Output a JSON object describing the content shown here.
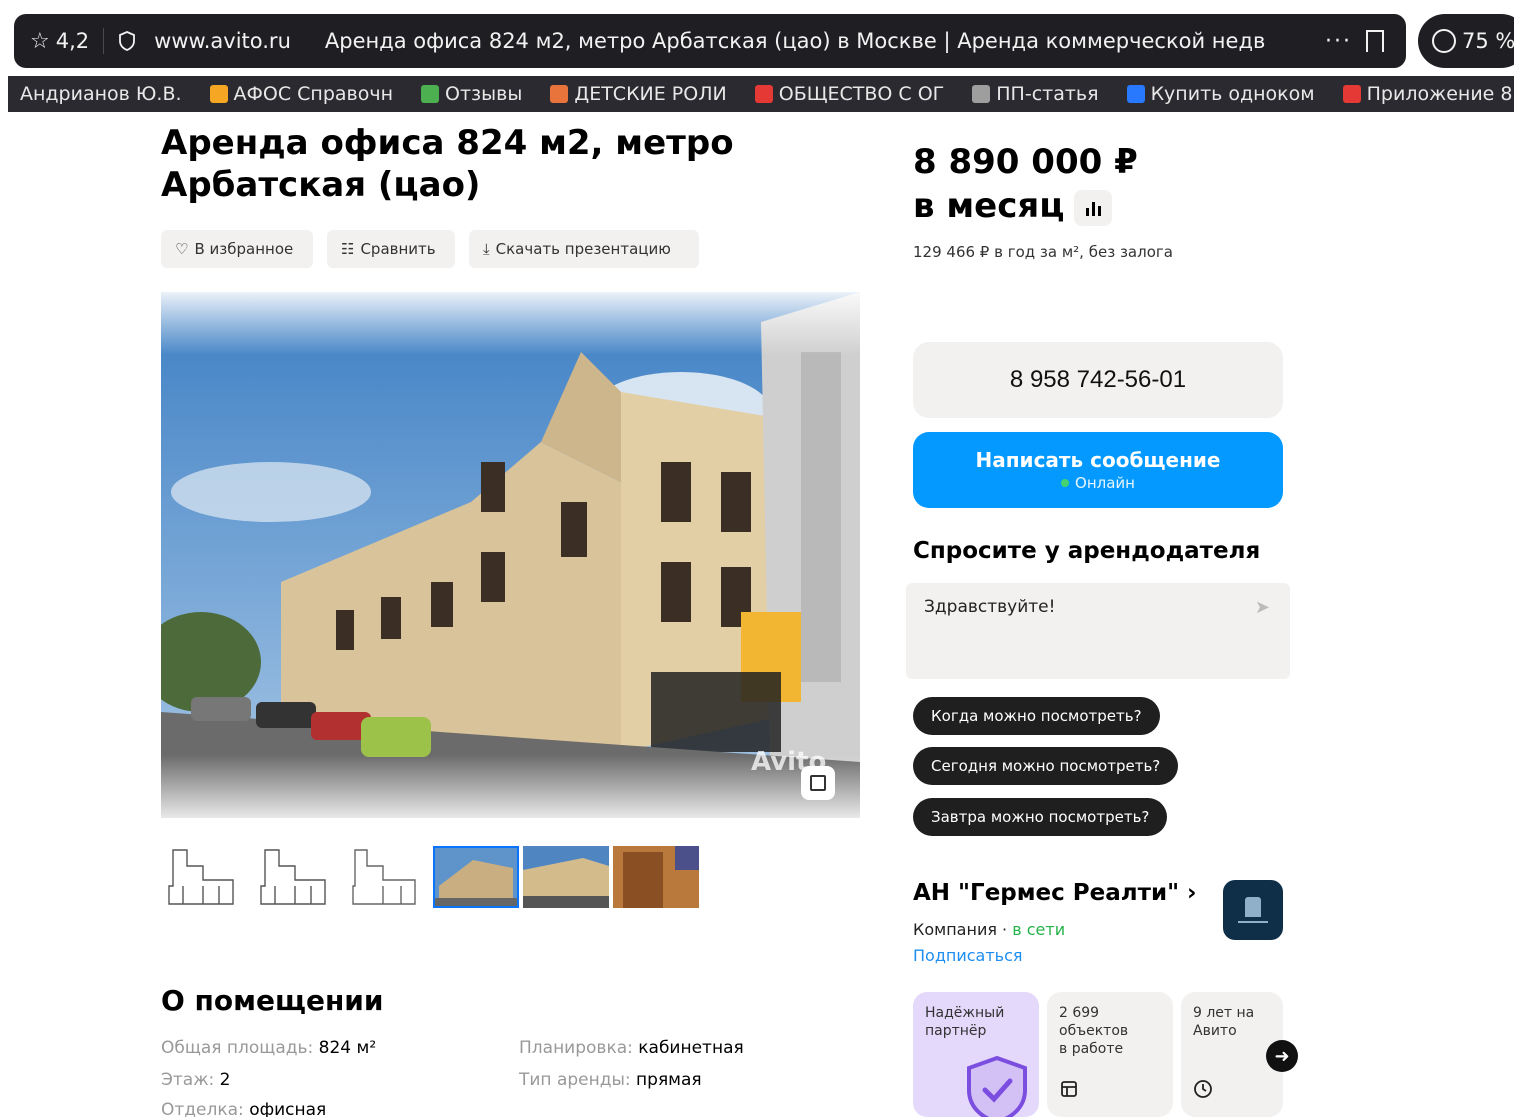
{
  "browser": {
    "rating": "4,2",
    "domain": "www.avito.ru",
    "page_title": "Аренда офиса 824 м2, метро Арбатская (цао) в Москве | Аренда коммерческой недви...",
    "more": "···",
    "zoom": "75 %"
  },
  "bookmarks": [
    {
      "label": "Андрианов Ю.В.",
      "color": "#7a7a80"
    },
    {
      "label": "АФОС Справочн",
      "color": "#f5a623"
    },
    {
      "label": "Отзывы",
      "color": "#4caf50"
    },
    {
      "label": "ДЕТСКИЕ РОЛИ",
      "color": "#e8743b"
    },
    {
      "label": "ОБЩЕСТВО С ОГ",
      "color": "#e53935"
    },
    {
      "label": "ПП-статья",
      "color": "#9e9e9e"
    },
    {
      "label": "Купить одноком",
      "color": "#2979ff"
    },
    {
      "label": "Приложение 8. С",
      "color": "#e53935"
    }
  ],
  "listing": {
    "title": "Аренда офиса 824 м2, метро Арбатская (цао)",
    "actions": {
      "favorite": "В избранное",
      "compare": "Сравнить",
      "download": "Скачать презентацию"
    },
    "watermark": "Avito"
  },
  "about": {
    "heading": "О помещении",
    "specs": [
      {
        "key": "Общая площадь: ",
        "value": "824 м²"
      },
      {
        "key": "Планировка: ",
        "value": "кабинетная"
      },
      {
        "key": "Этаж: ",
        "value": "2"
      },
      {
        "key": "Тип аренды: ",
        "value": "прямая"
      },
      {
        "key": "Отделка: ",
        "value": "офисная"
      }
    ]
  },
  "price": {
    "line1": "8 890 000 ₽",
    "line2": "в месяц",
    "sub": "129 466 ₽ в год за м², без залога"
  },
  "contact": {
    "phone": "8 958 742-56-01",
    "message_label": "Написать сообщение",
    "online_label": "Онлайн",
    "accent_color": "#0399ff"
  },
  "ask": {
    "heading": "Спросите у арендодателя",
    "message_value": "Здравствуйте!",
    "chips": [
      "Когда можно посмотреть?",
      "Сегодня можно посмотреть?",
      "Завтра можно посмотреть?"
    ]
  },
  "agency": {
    "name": "АН \"Гермес Реалти\" ›",
    "type": "Компания · ",
    "status": "в сети",
    "subscribe": "Подписаться",
    "cards": [
      {
        "text": "Надёжный партнёр"
      },
      {
        "text": "2 699 объектов в работе"
      },
      {
        "text": "9 лет на Авито"
      }
    ]
  }
}
